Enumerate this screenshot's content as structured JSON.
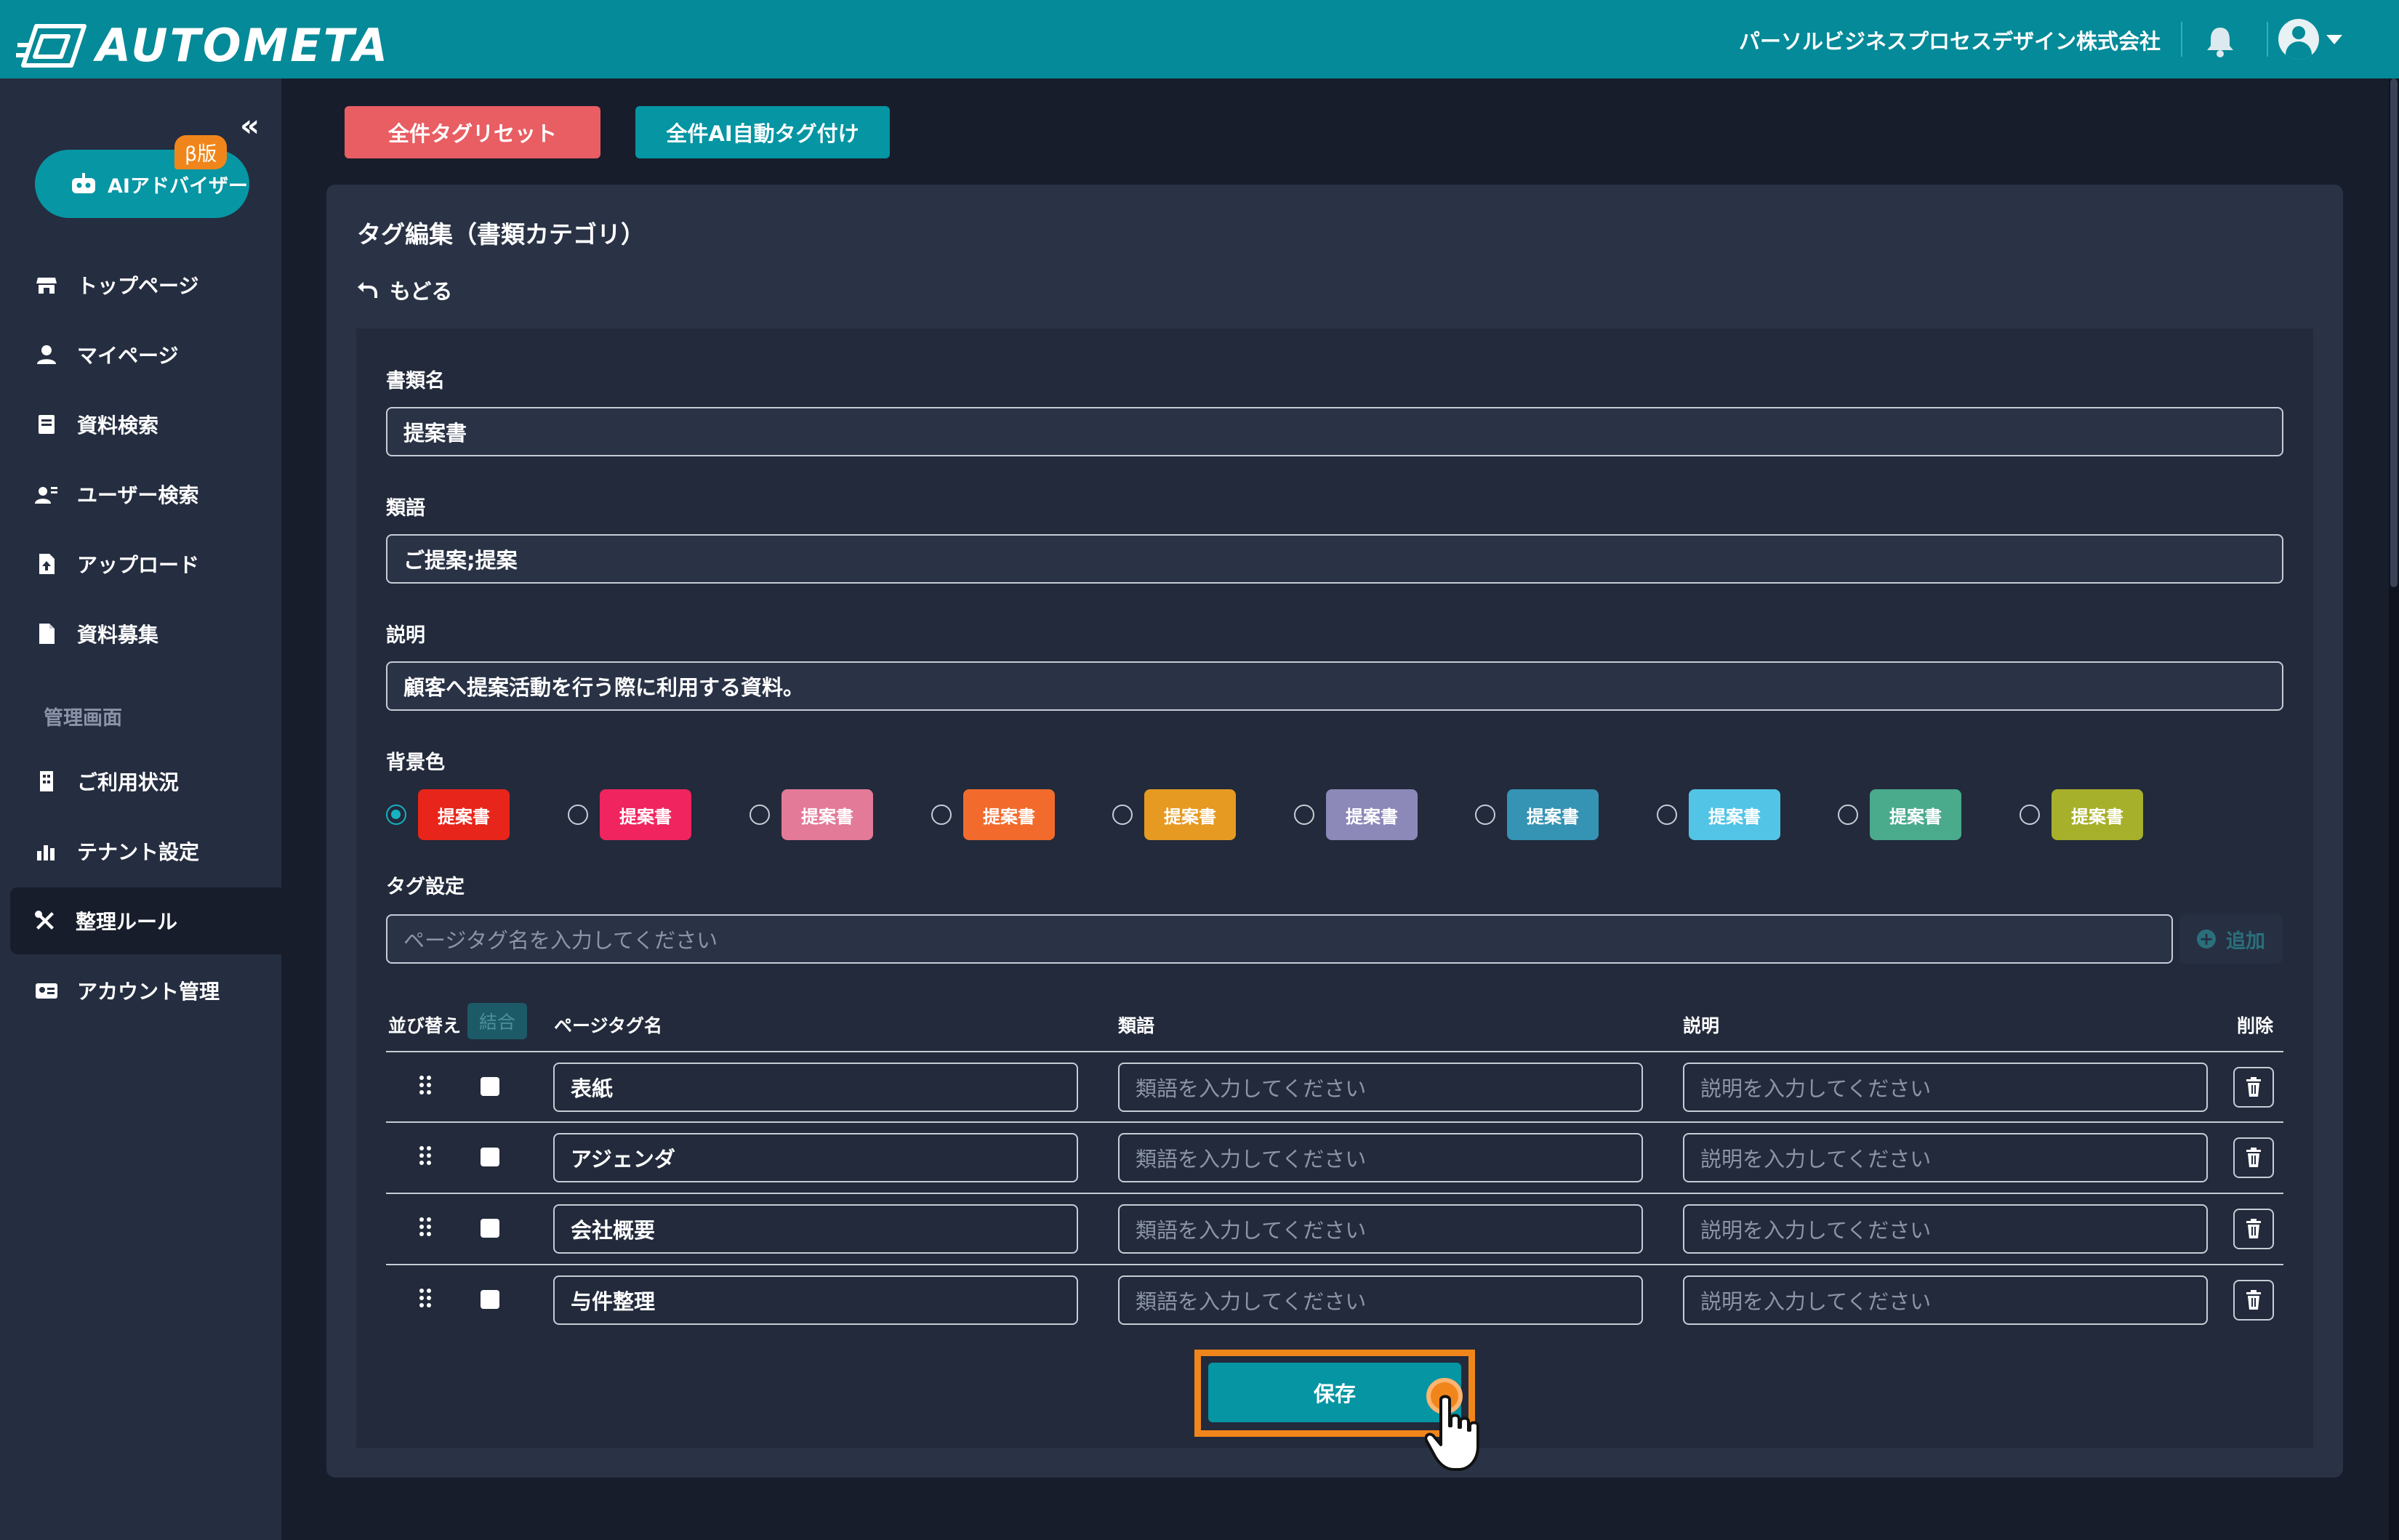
{
  "header": {
    "logo_text": "AUTOMETA",
    "company": "パーソルビジネスプロセスデザイン株式会社",
    "accent_color": "#048a98"
  },
  "sidebar": {
    "collapse_label": "«",
    "ai_advisor": {
      "label": "AIアドバイザー",
      "badge": "β版"
    },
    "items": [
      {
        "label": "トップページ",
        "icon": "store-icon"
      },
      {
        "label": "マイページ",
        "icon": "user-icon"
      },
      {
        "label": "資料検索",
        "icon": "document-search-icon"
      },
      {
        "label": "ユーザー検索",
        "icon": "user-search-icon"
      },
      {
        "label": "アップロード",
        "icon": "upload-icon"
      },
      {
        "label": "資料募集",
        "icon": "file-icon"
      }
    ],
    "section_label": "管理画面",
    "admin_items": [
      {
        "label": "ご利用状況",
        "icon": "building-icon"
      },
      {
        "label": "テナント設定",
        "icon": "chart-icon"
      },
      {
        "label": "整理ルール",
        "icon": "tools-icon",
        "active": true
      },
      {
        "label": "アカウント管理",
        "icon": "id-card-icon"
      }
    ]
  },
  "actions": {
    "reset_label": "全件タグリセット",
    "ai_tag_label": "全件AI自動タグ付け",
    "reset_color": "#e85e63",
    "ai_color": "#0595a3"
  },
  "page": {
    "title": "タグ編集（書類カテゴリ）",
    "back_label": "もどる"
  },
  "form": {
    "doc_name_label": "書類名",
    "doc_name_value": "提案書",
    "synonym_label": "類語",
    "synonym_value": "ご提案;提案",
    "desc_label": "説明",
    "desc_value": "顧客へ提案活動を行う際に利用する資料。",
    "bg_label": "背景色",
    "swatches": [
      {
        "label": "提案書",
        "color": "#e8251a",
        "selected": true
      },
      {
        "label": "提案書",
        "color": "#f0245f",
        "selected": false
      },
      {
        "label": "提案書",
        "color": "#e37a98",
        "selected": false
      },
      {
        "label": "提案書",
        "color": "#f26b2d",
        "selected": false
      },
      {
        "label": "提案書",
        "color": "#e69a22",
        "selected": false
      },
      {
        "label": "提案書",
        "color": "#8c88b8",
        "selected": false
      },
      {
        "label": "提案書",
        "color": "#3593b3",
        "selected": false
      },
      {
        "label": "提案書",
        "color": "#52c4e6",
        "selected": false
      },
      {
        "label": "提案書",
        "color": "#4aaa8c",
        "selected": false
      },
      {
        "label": "提案書",
        "color": "#a7b02a",
        "selected": false
      }
    ],
    "tag_setting_label": "タグ設定",
    "tag_input_placeholder": "ページタグ名を入力してください",
    "add_label": "追加"
  },
  "table": {
    "headers": {
      "sort": "並び替え",
      "merge": "結合",
      "page_tag": "ページタグ名",
      "synonym": "類語",
      "desc": "説明",
      "delete": "削除"
    },
    "synonym_placeholder": "類語を入力してください",
    "desc_placeholder": "説明を入力してください",
    "rows": [
      {
        "tag": "表紙"
      },
      {
        "tag": "アジェンダ"
      },
      {
        "tag": "会社概要"
      },
      {
        "tag": "与件整理"
      }
    ]
  },
  "save_label": "保存"
}
